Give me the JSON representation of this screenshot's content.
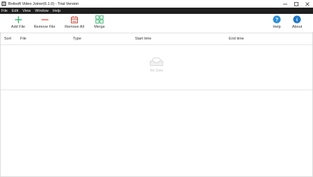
{
  "window": {
    "title": "Bolisoft Video Joiner(6.1.0) - Trial Version",
    "controls": [
      "minimize-icon",
      "maximize-icon",
      "close-icon"
    ]
  },
  "menu": {
    "items": [
      {
        "label": "File"
      },
      {
        "label": "Edit"
      },
      {
        "label": "View"
      },
      {
        "label": "Window"
      },
      {
        "label": "Help"
      }
    ]
  },
  "toolbar": {
    "add_file": {
      "label": "Add File",
      "icon": "plus-icon",
      "color": "#27ae60"
    },
    "remove_file": {
      "label": "Remove File",
      "icon": "minus-icon",
      "color": "#e74c3c"
    },
    "remove_all": {
      "label": "Remove All",
      "icon": "remove-all-icon",
      "color": "#c0392b"
    },
    "merge": {
      "label": "Merge",
      "icon": "merge-icon",
      "color": "#27ae60"
    },
    "help": {
      "label": "Help",
      "icon": "question-icon",
      "color": "#2b8fd6"
    },
    "about": {
      "label": "About",
      "icon": "info-icon",
      "color": "#1f78c8"
    }
  },
  "table": {
    "columns": [
      "Sort",
      "File",
      "Type",
      "Start time",
      "End time"
    ],
    "rows": [],
    "empty_text": "No Data"
  }
}
